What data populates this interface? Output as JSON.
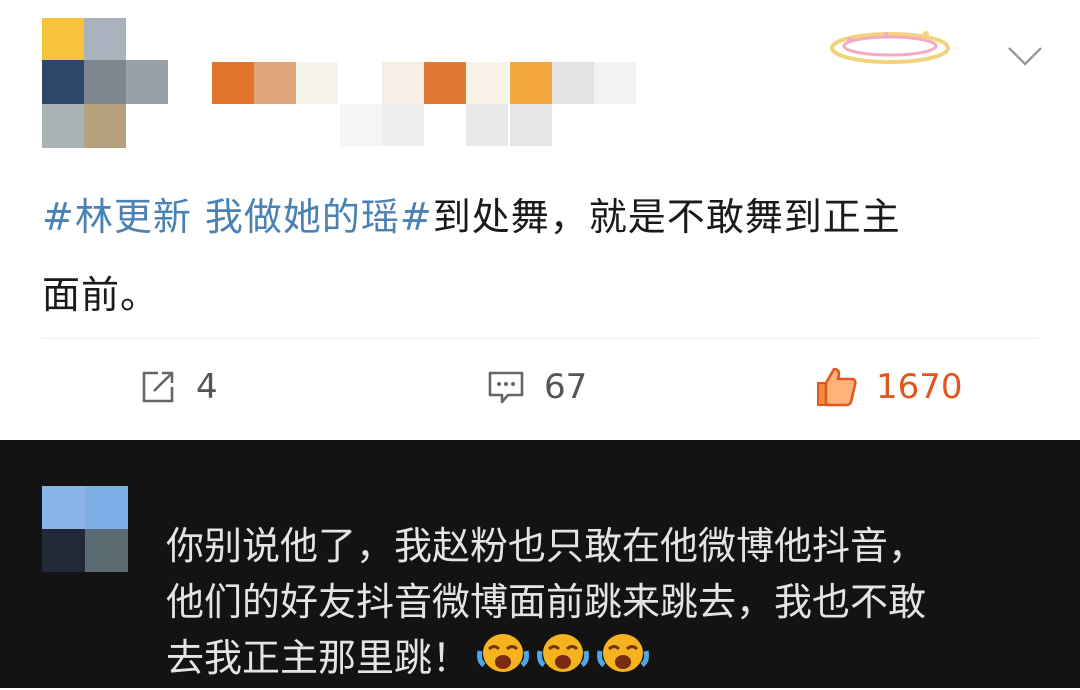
{
  "post": {
    "topic": "#林更新 我做她的瑶#",
    "text_line1": "到处舞，就是不敢舞到正主",
    "text_line2": "面前。"
  },
  "actions": {
    "repost_count": "4",
    "comment_count": "67",
    "like_count": "1670"
  },
  "comment": {
    "line1": "你别说他了，我赵粉也只敢在他微博他抖音，",
    "line2": "他们的好友抖音微博面前跳来跳去，我也不敢",
    "line3": "去我正主那里跳！"
  },
  "colors": {
    "topic": "#4a82b4",
    "like": "#e0571f",
    "dark_background": "#131313"
  },
  "icons": [
    "repost-icon",
    "comment-icon",
    "like-icon",
    "chevron-down-icon",
    "crying-emoji-icon"
  ]
}
